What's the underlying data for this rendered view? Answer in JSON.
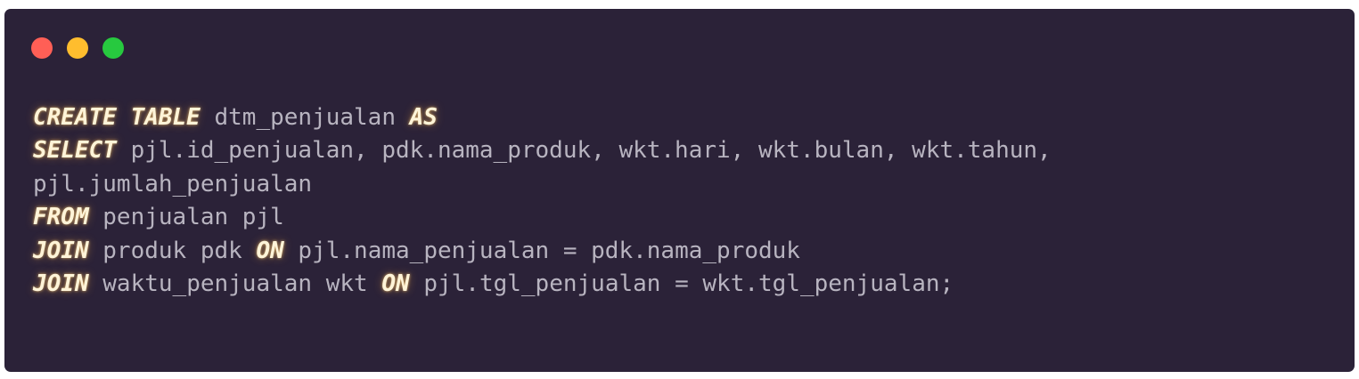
{
  "window": {
    "controls": [
      {
        "name": "close-dot",
        "color": "#ff5f56"
      },
      {
        "name": "minimize-dot",
        "color": "#ffbd2e"
      },
      {
        "name": "maximize-dot",
        "color": "#27c93f"
      }
    ]
  },
  "code": {
    "lines": [
      [
        {
          "t": "kw",
          "v": "CREATE TABLE"
        },
        {
          "t": "txt",
          "v": " dtm_penjualan "
        },
        {
          "t": "kw",
          "v": "AS"
        }
      ],
      [
        {
          "t": "kw",
          "v": "SELECT"
        },
        {
          "t": "txt",
          "v": " pjl.id_penjualan, pdk.nama_produk, wkt.hari, wkt.bulan, wkt.tahun,"
        }
      ],
      [
        {
          "t": "txt",
          "v": "pjl.jumlah_penjualan"
        }
      ],
      [
        {
          "t": "kw",
          "v": "FROM"
        },
        {
          "t": "txt",
          "v": " penjualan pjl"
        }
      ],
      [
        {
          "t": "kw",
          "v": "JOIN"
        },
        {
          "t": "txt",
          "v": " produk pdk "
        },
        {
          "t": "kw",
          "v": "ON"
        },
        {
          "t": "txt",
          "v": " pjl.nama_penjualan = pdk.nama_produk"
        }
      ],
      [
        {
          "t": "kw",
          "v": "JOIN"
        },
        {
          "t": "txt",
          "v": " waktu_penjualan wkt "
        },
        {
          "t": "kw",
          "v": "ON"
        },
        {
          "t": "txt",
          "v": " pjl.tgl_penjualan = wkt.tgl_penjualan;"
        }
      ]
    ]
  }
}
